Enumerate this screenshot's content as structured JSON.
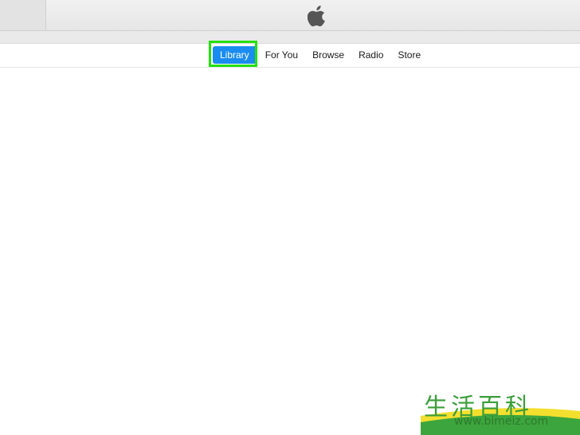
{
  "nav": {
    "tabs": [
      {
        "label": "Library",
        "active": true
      },
      {
        "label": "For You",
        "active": false
      },
      {
        "label": "Browse",
        "active": false
      },
      {
        "label": "Radio",
        "active": false
      },
      {
        "label": "Store",
        "active": false
      }
    ]
  },
  "colors": {
    "active_tab": "#1a8cf0",
    "highlight": "#24e10f"
  },
  "icons": {
    "title": "apple-logo-icon"
  },
  "watermark": {
    "chars": "生活百科",
    "url": "www.bimeiz.com"
  }
}
